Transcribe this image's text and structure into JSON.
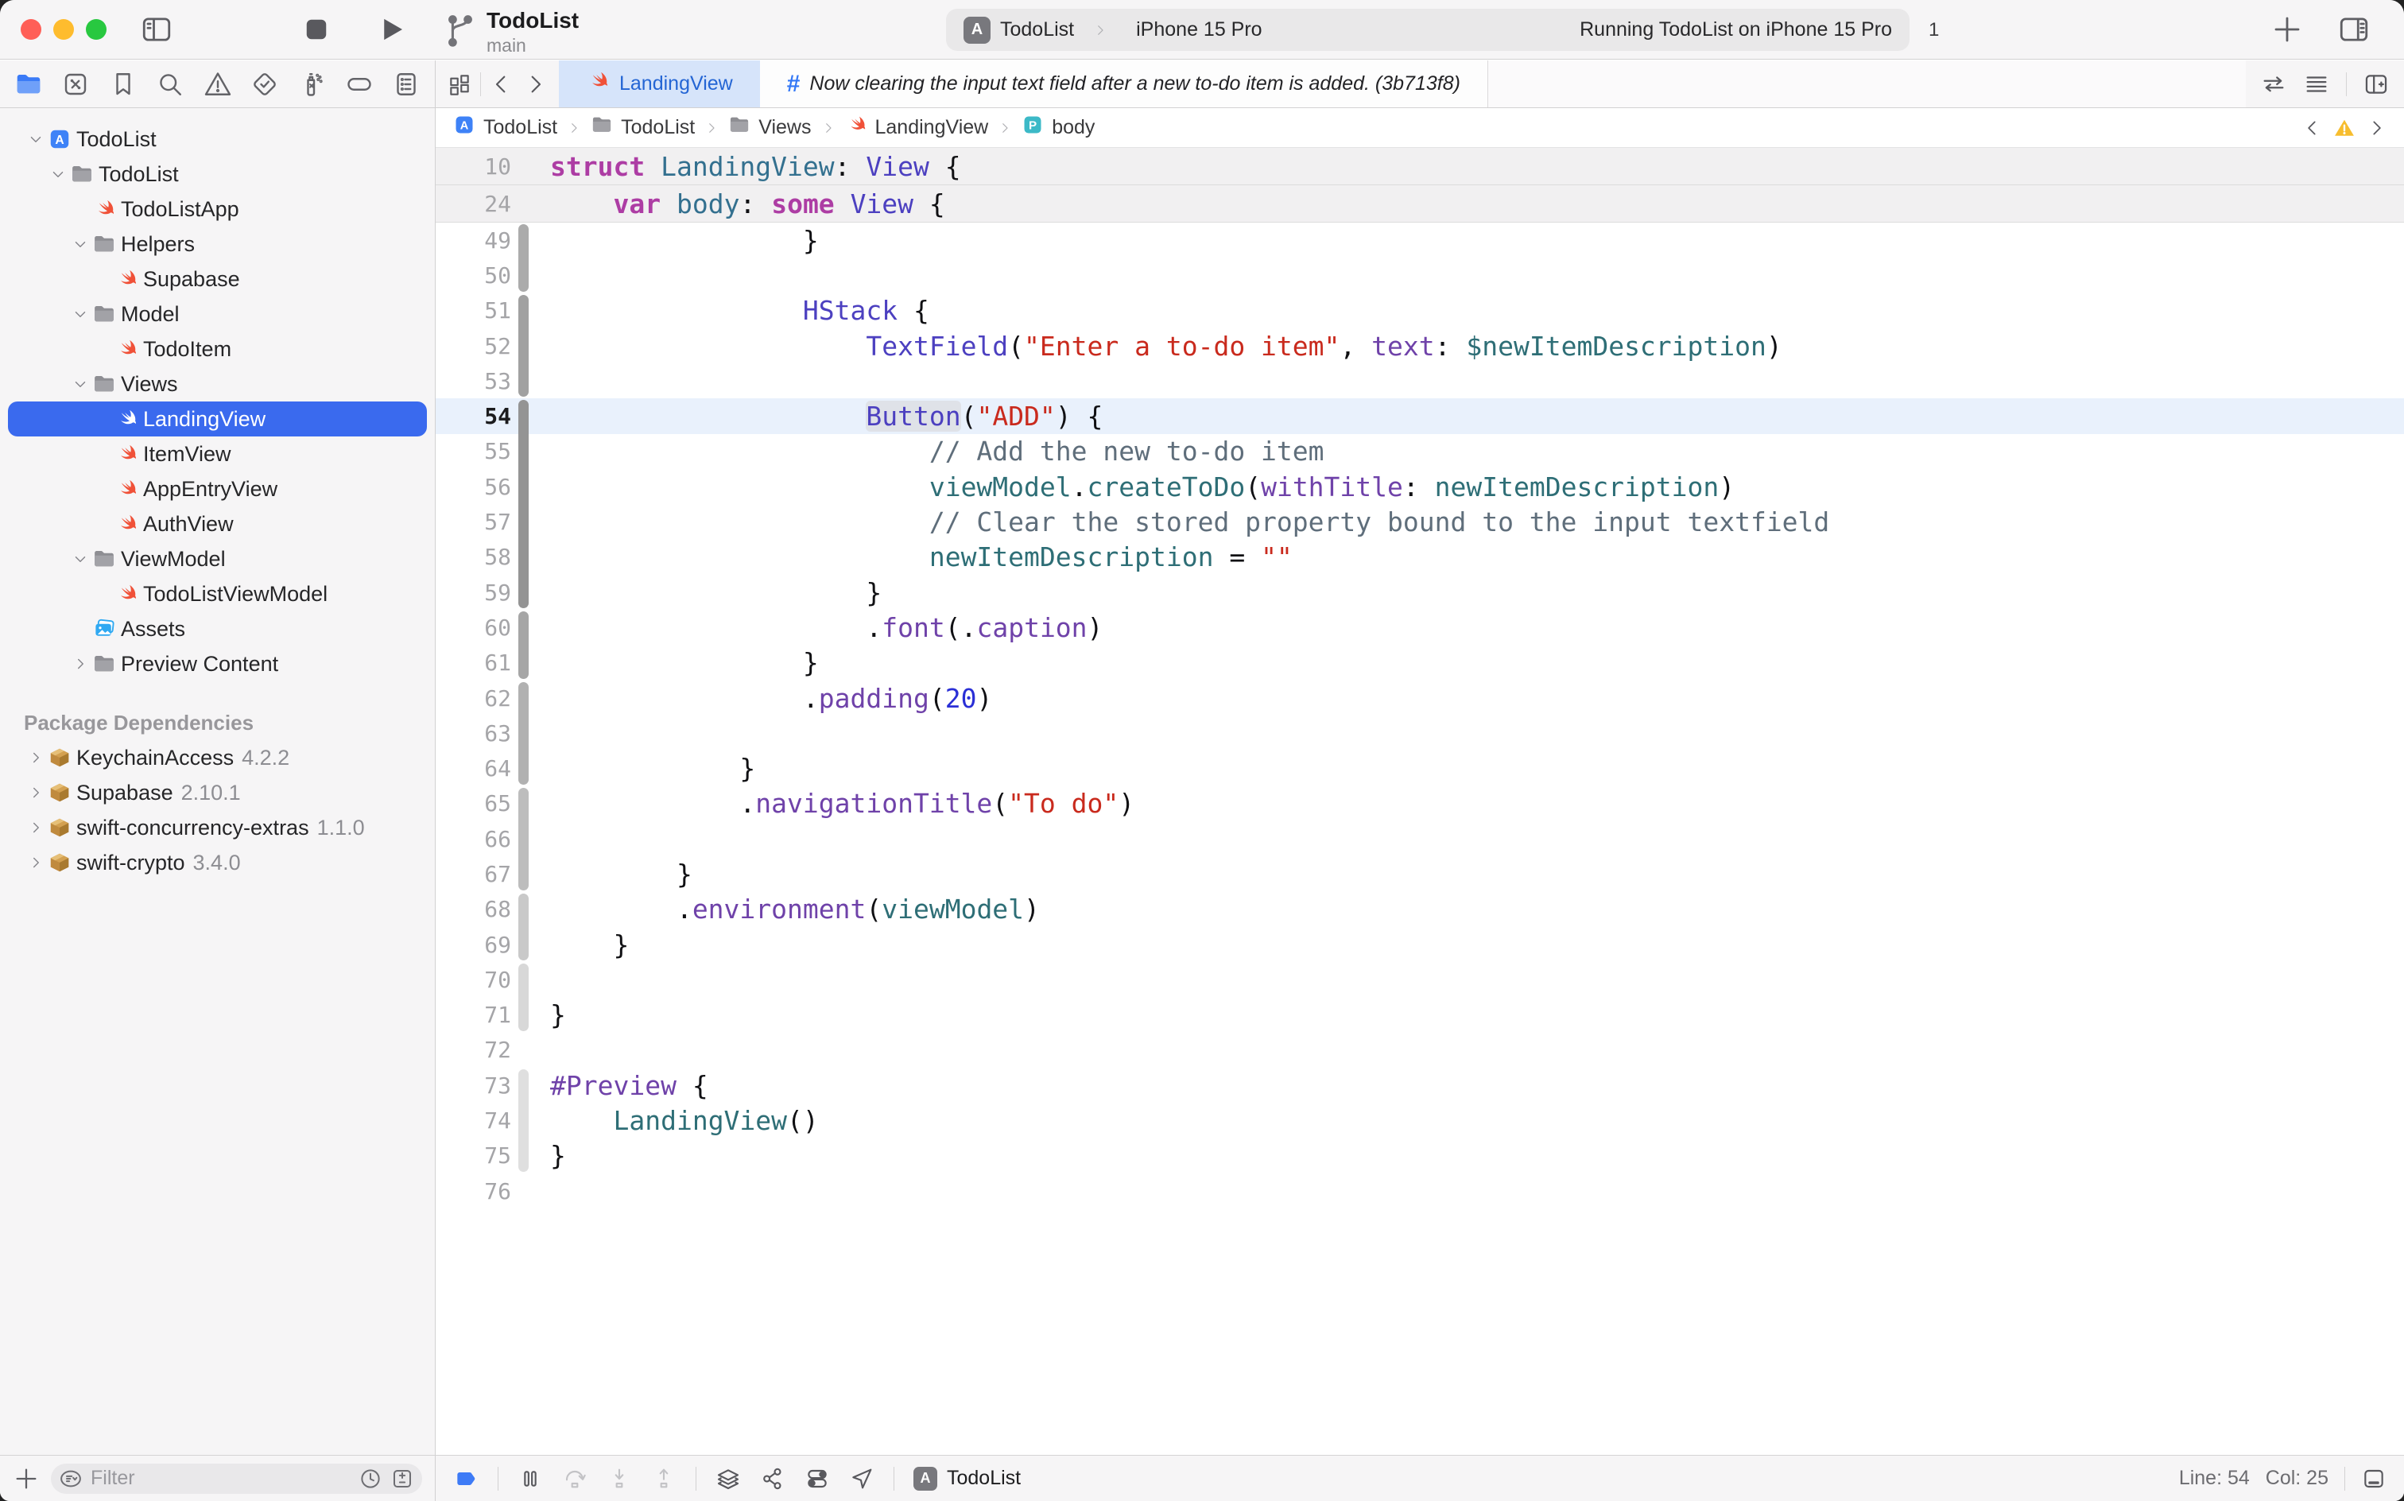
{
  "titlebar": {
    "project": "TodoList",
    "branch": "main",
    "scheme": {
      "app": "TodoList",
      "device": "iPhone 15 Pro",
      "status": "Running TodoList on iPhone 15 Pro"
    },
    "warning_count": "1",
    "accent_blue": "#3a6aee",
    "warning_yellow": "#f7bd2e"
  },
  "navigator": {
    "tabs": [
      {
        "name": "project-navigator",
        "icon": "folder-fill",
        "active": true
      },
      {
        "name": "source-control-navigator",
        "icon": "square-x"
      },
      {
        "name": "bookmark-navigator",
        "icon": "bookmark"
      },
      {
        "name": "find-navigator",
        "icon": "search"
      },
      {
        "name": "issue-navigator",
        "icon": "warning"
      },
      {
        "name": "test-navigator",
        "icon": "test-diamond"
      },
      {
        "name": "debug-navigator",
        "icon": "spray"
      },
      {
        "name": "breakpoint-navigator",
        "icon": "capsule"
      },
      {
        "name": "report-navigator",
        "icon": "report"
      }
    ],
    "tree": [
      {
        "depth": 0,
        "disc": "down",
        "icon": "app-blue",
        "label": "TodoList"
      },
      {
        "depth": 1,
        "disc": "down",
        "icon": "folder",
        "label": "TodoList"
      },
      {
        "depth": 2,
        "icon": "swift",
        "label": "TodoListApp"
      },
      {
        "depth": 2,
        "disc": "down",
        "icon": "folder",
        "label": "Helpers"
      },
      {
        "depth": 3,
        "icon": "swift",
        "label": "Supabase"
      },
      {
        "depth": 2,
        "disc": "down",
        "icon": "folder",
        "label": "Model"
      },
      {
        "depth": 3,
        "icon": "swift",
        "label": "TodoItem"
      },
      {
        "depth": 2,
        "disc": "down",
        "icon": "folder",
        "label": "Views"
      },
      {
        "depth": 3,
        "icon": "swift",
        "label": "LandingView",
        "selected": true
      },
      {
        "depth": 3,
        "icon": "swift",
        "label": "ItemView"
      },
      {
        "depth": 3,
        "icon": "swift",
        "label": "AppEntryView"
      },
      {
        "depth": 3,
        "icon": "swift",
        "label": "AuthView"
      },
      {
        "depth": 2,
        "disc": "down",
        "icon": "folder",
        "label": "ViewModel"
      },
      {
        "depth": 3,
        "icon": "swift",
        "label": "TodoListViewModel"
      },
      {
        "depth": 2,
        "icon": "assets",
        "label": "Assets"
      },
      {
        "depth": 2,
        "disc": "right",
        "icon": "folder",
        "label": "Preview Content"
      }
    ],
    "package_header": "Package Dependencies",
    "packages": [
      {
        "name": "KeychainAccess",
        "version": "4.2.2"
      },
      {
        "name": "Supabase",
        "version": "2.10.1"
      },
      {
        "name": "swift-concurrency-extras",
        "version": "1.1.0"
      },
      {
        "name": "swift-crypto",
        "version": "3.4.0"
      }
    ],
    "filter_placeholder": "Filter"
  },
  "editor": {
    "tabs": [
      {
        "icon": "swift",
        "label": "LandingView",
        "active": true
      },
      {
        "icon": "hash",
        "label": "Now clearing the input text field after a new to-do item is added. (3b713f8)"
      }
    ],
    "breadcrumb": [
      {
        "icon": "app-blue",
        "label": "TodoList"
      },
      {
        "icon": "folder",
        "label": "TodoList"
      },
      {
        "icon": "folder",
        "label": "Views"
      },
      {
        "icon": "swift",
        "label": "LandingView"
      },
      {
        "icon": "p-badge",
        "label": "body"
      }
    ],
    "sticky": [
      {
        "n": "10",
        "t": [
          [
            "k",
            "struct"
          ],
          [
            "p",
            " "
          ],
          [
            "d",
            "LandingView"
          ],
          [
            "p",
            ": "
          ],
          [
            "t",
            "View"
          ],
          [
            "p",
            " {"
          ]
        ]
      },
      {
        "n": "24",
        "t": [
          [
            "p",
            "    "
          ],
          [
            "k",
            "var"
          ],
          [
            "p",
            " "
          ],
          [
            "d",
            "body"
          ],
          [
            "p",
            ": "
          ],
          [
            "k",
            "some"
          ],
          [
            "p",
            " "
          ],
          [
            "t",
            "View"
          ],
          [
            "p",
            " {"
          ]
        ]
      }
    ],
    "ribbon_colors": {
      "g1": "#ababab",
      "g2": "#a1a1a1",
      "g3": "#949494",
      "g4": "#a6a6a6",
      "g5": "#b1b1b1",
      "g6": "#bdbdbd",
      "g7": "#c9c9c9",
      "g8": "#d8d8d8",
      "g9": "#dfdfdf"
    },
    "lines": [
      {
        "n": "49",
        "r": "g1",
        "t": [
          [
            "p",
            "                }"
          ]
        ]
      },
      {
        "n": "50",
        "r": "g1",
        "t": []
      },
      {
        "n": "51",
        "r": "g2",
        "t": [
          [
            "p",
            "                "
          ],
          [
            "t",
            "HStack"
          ],
          [
            "p",
            " {"
          ]
        ]
      },
      {
        "n": "52",
        "r": "g2",
        "t": [
          [
            "p",
            "                    "
          ],
          [
            "t",
            "TextField"
          ],
          [
            "p",
            "("
          ],
          [
            "s",
            "\"Enter a to-do item\""
          ],
          [
            "p",
            ", "
          ],
          [
            "m",
            "text"
          ],
          [
            "p",
            ": "
          ],
          [
            "j",
            "$newItemDescription"
          ],
          [
            "p",
            ")"
          ]
        ]
      },
      {
        "n": "53",
        "r": "g2",
        "t": []
      },
      {
        "n": "54",
        "r": "g3",
        "hl": true,
        "t": [
          [
            "p",
            "                    "
          ],
          [
            "t hl",
            "Button"
          ],
          [
            "p",
            "("
          ],
          [
            "s",
            "\"ADD\""
          ],
          [
            "p",
            ") {"
          ]
        ]
      },
      {
        "n": "55",
        "r": "g3",
        "t": [
          [
            "p",
            "                        "
          ],
          [
            "c",
            "// Add the new to-do item"
          ]
        ]
      },
      {
        "n": "56",
        "r": "g3",
        "t": [
          [
            "p",
            "                        "
          ],
          [
            "j",
            "viewModel"
          ],
          [
            "p",
            "."
          ],
          [
            "j",
            "createToDo"
          ],
          [
            "p",
            "("
          ],
          [
            "m",
            "withTitle"
          ],
          [
            "p",
            ": "
          ],
          [
            "j",
            "newItemDescription"
          ],
          [
            "p",
            ")"
          ]
        ]
      },
      {
        "n": "57",
        "r": "g3",
        "t": [
          [
            "p",
            "                        "
          ],
          [
            "c",
            "// Clear the stored property bound to the input textfield"
          ]
        ]
      },
      {
        "n": "58",
        "r": "g3",
        "t": [
          [
            "p",
            "                        "
          ],
          [
            "j",
            "newItemDescription"
          ],
          [
            "p",
            " = "
          ],
          [
            "s",
            "\"\""
          ]
        ]
      },
      {
        "n": "59",
        "r": "g3",
        "t": [
          [
            "p",
            "                    }"
          ]
        ]
      },
      {
        "n": "60",
        "r": "g4",
        "t": [
          [
            "p",
            "                    ."
          ],
          [
            "m",
            "font"
          ],
          [
            "p",
            "(."
          ],
          [
            "m",
            "caption"
          ],
          [
            "p",
            ")"
          ]
        ]
      },
      {
        "n": "61",
        "r": "g4",
        "t": [
          [
            "p",
            "                }"
          ]
        ]
      },
      {
        "n": "62",
        "r": "g5",
        "t": [
          [
            "p",
            "                ."
          ],
          [
            "m",
            "padding"
          ],
          [
            "p",
            "("
          ],
          [
            "n",
            "20"
          ],
          [
            "p",
            ")"
          ]
        ]
      },
      {
        "n": "63",
        "r": "g5",
        "t": []
      },
      {
        "n": "64",
        "r": "g5",
        "t": [
          [
            "p",
            "            }"
          ]
        ]
      },
      {
        "n": "65",
        "r": "g6",
        "t": [
          [
            "p",
            "            ."
          ],
          [
            "m",
            "navigationTitle"
          ],
          [
            "p",
            "("
          ],
          [
            "s",
            "\"To do\""
          ],
          [
            "p",
            ")"
          ]
        ]
      },
      {
        "n": "66",
        "r": "g6",
        "t": []
      },
      {
        "n": "67",
        "r": "g6",
        "t": [
          [
            "p",
            "        }"
          ]
        ]
      },
      {
        "n": "68",
        "r": "g7",
        "t": [
          [
            "p",
            "        ."
          ],
          [
            "m",
            "environment"
          ],
          [
            "p",
            "("
          ],
          [
            "j",
            "viewModel"
          ],
          [
            "p",
            ")"
          ]
        ]
      },
      {
        "n": "69",
        "r": "g7",
        "t": [
          [
            "p",
            "    }"
          ]
        ]
      },
      {
        "n": "70",
        "r": "g8",
        "t": []
      },
      {
        "n": "71",
        "r": "g8",
        "t": [
          [
            "p",
            "}"
          ]
        ]
      },
      {
        "n": "72",
        "r": null,
        "t": []
      },
      {
        "n": "73",
        "r": "g9",
        "t": [
          [
            "m",
            "#Preview"
          ],
          [
            "p",
            " {"
          ]
        ]
      },
      {
        "n": "74",
        "r": "g9",
        "t": [
          [
            "p",
            "    "
          ],
          [
            "j",
            "LandingView"
          ],
          [
            "p",
            "()"
          ]
        ]
      },
      {
        "n": "75",
        "r": "g9",
        "t": [
          [
            "p",
            "}"
          ]
        ]
      },
      {
        "n": "76",
        "r": null,
        "t": []
      }
    ]
  },
  "debugbar": {
    "app": "TodoList"
  },
  "statusbar": {
    "line": "Line: 54",
    "col": "Col: 25"
  }
}
